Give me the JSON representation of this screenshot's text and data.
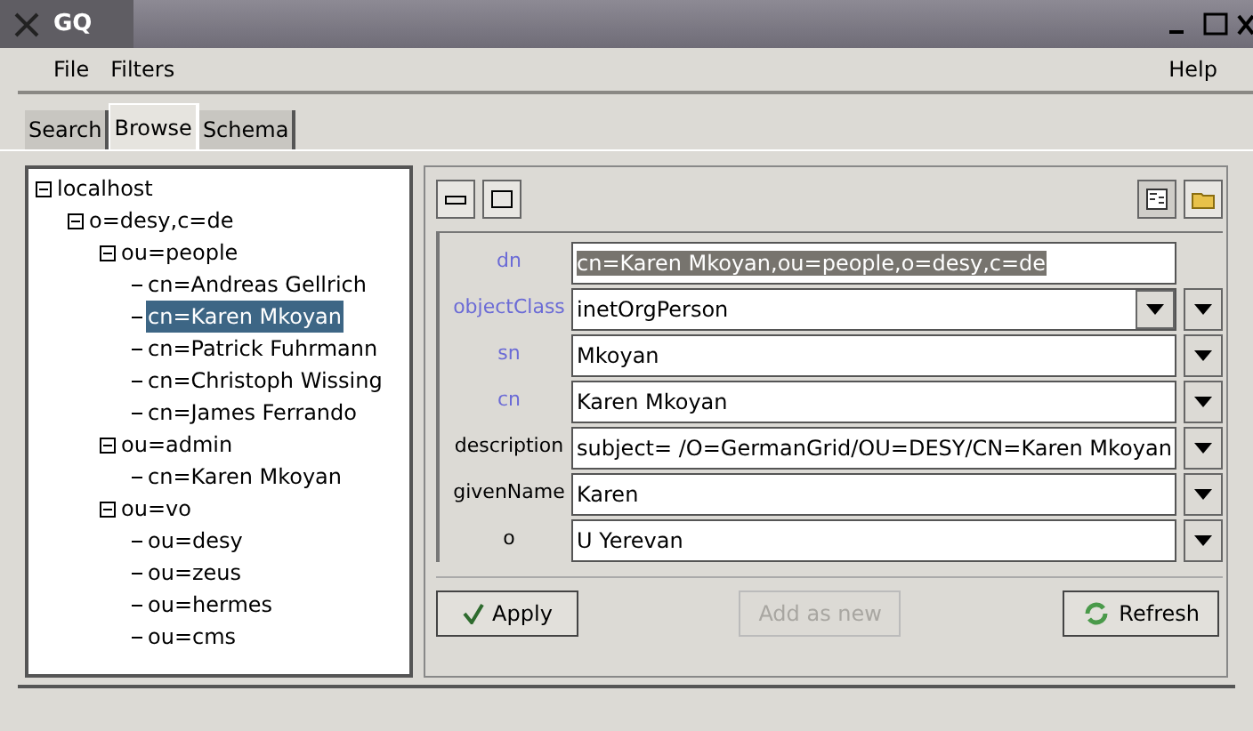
{
  "window": {
    "title": "GQ"
  },
  "menu": [
    "File",
    "Filters",
    "Help"
  ],
  "tabs": [
    {
      "label": "Search",
      "selected": false
    },
    {
      "label": "Browse",
      "selected": true
    },
    {
      "label": "Schema",
      "selected": false
    }
  ],
  "tree": [
    {
      "label": "localhost",
      "expanded": true,
      "selected": false,
      "children": [
        {
          "label": "o=desy,c=de",
          "expanded": true,
          "selected": false,
          "children": [
            {
              "label": "ou=people",
              "expanded": true,
              "selected": false,
              "children": [
                {
                  "label": "cn=Andreas Gellrich",
                  "selected": false
                },
                {
                  "label": "cn=Karen Mkoyan",
                  "selected": true
                },
                {
                  "label": "cn=Patrick Fuhrmann",
                  "selected": false
                },
                {
                  "label": "cn=Christoph Wissing",
                  "selected": false
                },
                {
                  "label": "cn=James Ferrando",
                  "selected": false
                }
              ]
            },
            {
              "label": "ou=admin",
              "expanded": true,
              "selected": false,
              "children": [
                {
                  "label": "cn=Karen Mkoyan",
                  "selected": false
                }
              ]
            },
            {
              "label": "ou=vo",
              "expanded": true,
              "selected": false,
              "children": [
                {
                  "label": "ou=desy",
                  "selected": false
                },
                {
                  "label": "ou=zeus",
                  "selected": false
                },
                {
                  "label": "ou=hermes",
                  "selected": false
                },
                {
                  "label": "ou=cms",
                  "selected": false
                }
              ]
            }
          ]
        }
      ]
    }
  ],
  "attributes": [
    {
      "name": "dn",
      "required": true,
      "kind": "dn",
      "value": "cn=Karen Mkoyan,ou=people,o=desy,c=de"
    },
    {
      "name": "objectClass",
      "required": true,
      "kind": "combo",
      "value": "inetOrgPerson"
    },
    {
      "name": "sn",
      "required": true,
      "kind": "text",
      "value": "Mkoyan"
    },
    {
      "name": "cn",
      "required": true,
      "kind": "text",
      "value": "Karen Mkoyan"
    },
    {
      "name": "description",
      "required": false,
      "kind": "text",
      "value": "subject= /O=GermanGrid/OU=DESY/CN=Karen Mkoyan"
    },
    {
      "name": "givenName",
      "required": false,
      "kind": "text",
      "value": "Karen"
    },
    {
      "name": "o",
      "required": false,
      "kind": "text",
      "value": "U Yerevan"
    }
  ],
  "buttons": [
    {
      "label": "Apply",
      "kind": "apply",
      "disabled": false
    },
    {
      "label": "Add as new",
      "kind": "plain",
      "disabled": true
    },
    {
      "label": "Refresh",
      "kind": "refresh",
      "disabled": false
    }
  ]
}
